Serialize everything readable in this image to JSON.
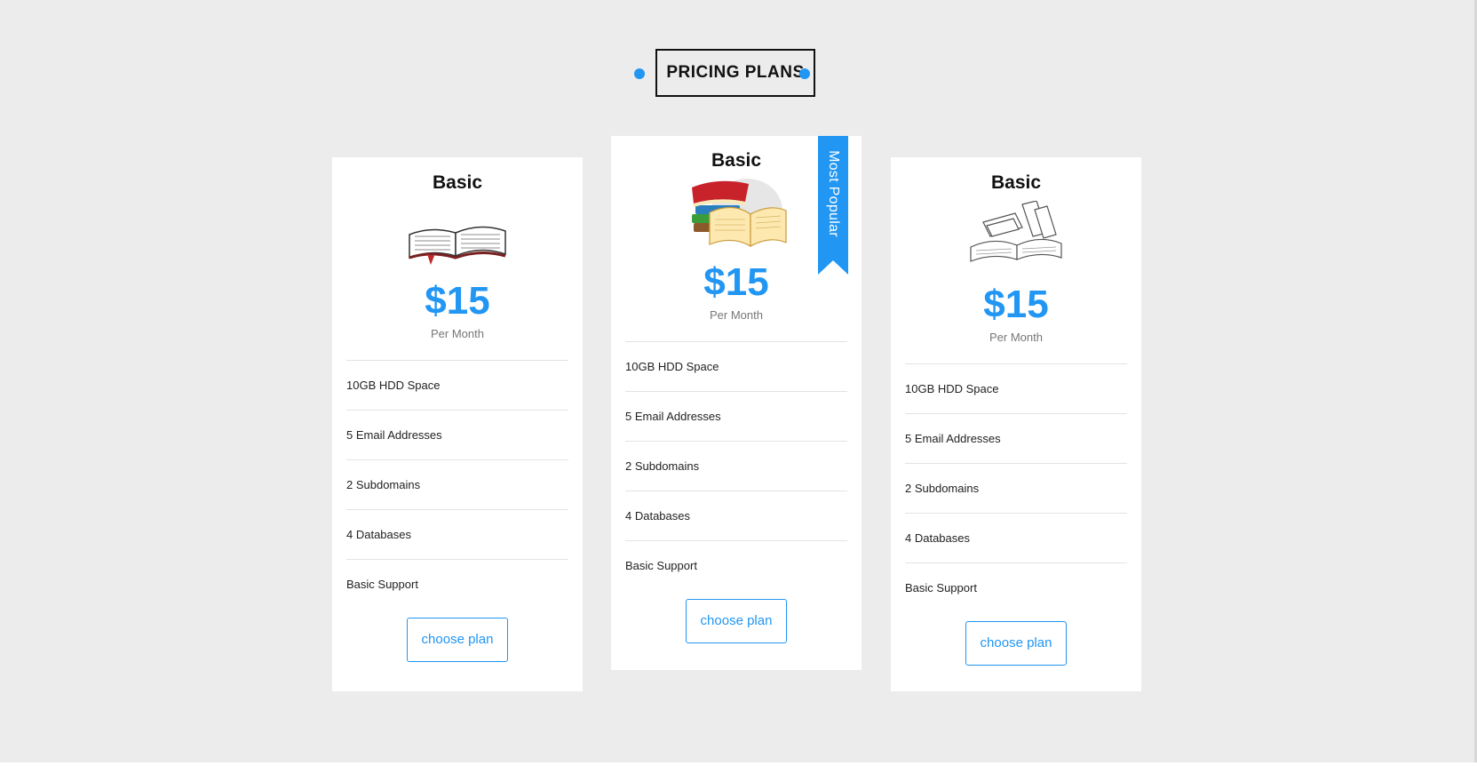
{
  "section": {
    "heading": "PRICING PLANS"
  },
  "colors": {
    "accent": "#2196f3",
    "page_background": "#ececec",
    "card_background": "#ffffff"
  },
  "plans": [
    {
      "title": "Basic",
      "image_icon": "open-book-illustration",
      "price": "$15",
      "period": "Per Month",
      "features": [
        "10GB HDD Space",
        "5 Email Addresses",
        "2 Subdomains",
        "4 Databases",
        "Basic Support"
      ],
      "button_label": "choose plan"
    },
    {
      "title": "Basic",
      "image_icon": "stack-of-books-illustration",
      "badge": "Most Popular",
      "price": "$15",
      "period": "Per Month",
      "features": [
        "10GB HDD Space",
        "5 Email Addresses",
        "2 Subdomains",
        "4 Databases",
        "Basic Support"
      ],
      "button_label": "choose plan"
    },
    {
      "title": "Basic",
      "image_icon": "books-sketch-illustration",
      "price": "$15",
      "period": "Per Month",
      "features": [
        "10GB HDD Space",
        "5 Email Addresses",
        "2 Subdomains",
        "4 Databases",
        "Basic Support"
      ],
      "button_label": "choose plan"
    }
  ]
}
